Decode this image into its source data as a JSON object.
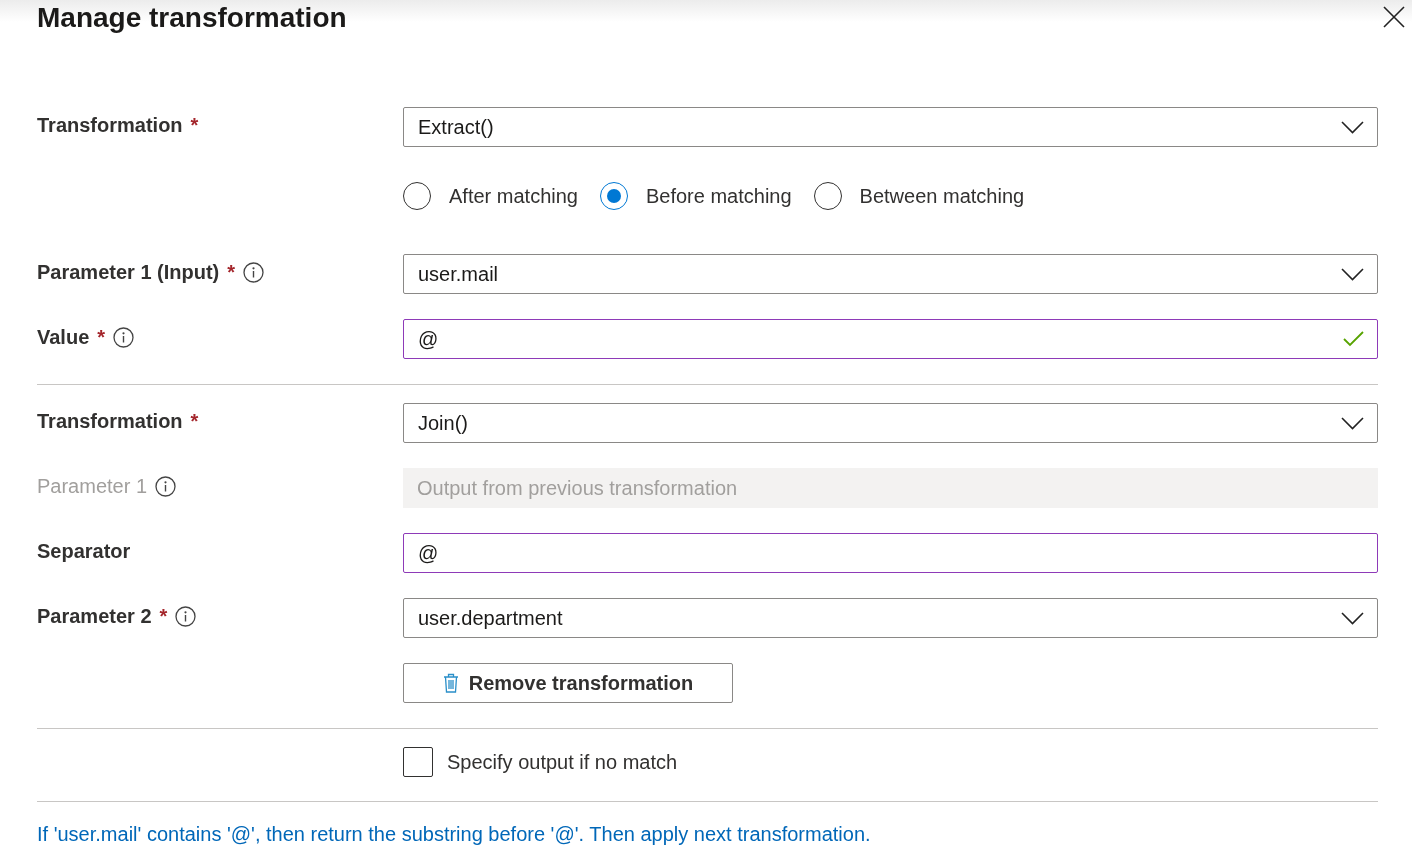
{
  "title": "Manage transformation",
  "sections": [
    {
      "rows": [
        {
          "kind": "dropdown",
          "label": "Transformation",
          "required_mark": "*",
          "info": false,
          "value": "Extract()"
        },
        {
          "kind": "radios",
          "options": [
            {
              "label": "After matching",
              "selected": false
            },
            {
              "label": "Before matching",
              "selected": true
            },
            {
              "label": "Between matching",
              "selected": false
            }
          ]
        },
        {
          "kind": "dropdown",
          "label": "Parameter 1 (Input)",
          "required_mark": "*",
          "info": true,
          "value": "user.mail"
        },
        {
          "kind": "text",
          "label": "Value",
          "required_mark": "*",
          "info": true,
          "value": "@",
          "valid": true
        }
      ]
    },
    {
      "rows": [
        {
          "kind": "dropdown",
          "label": "Transformation",
          "required_mark": "*",
          "info": false,
          "value": "Join()"
        },
        {
          "kind": "disabled",
          "label": "Parameter 1",
          "info": true,
          "placeholder": "Output from previous transformation"
        },
        {
          "kind": "text",
          "label": "Separator",
          "info": false,
          "value": "@",
          "valid": false
        },
        {
          "kind": "dropdown",
          "label": "Parameter 2",
          "required_mark": "*",
          "info": true,
          "value": "user.department"
        },
        {
          "kind": "button",
          "label": "Remove transformation"
        }
      ]
    },
    {
      "rows": [
        {
          "kind": "checkbox",
          "label": "Specify output if no match",
          "checked": false
        }
      ]
    }
  ],
  "summary": "If 'user.mail' contains '@', then return the substring before '@'. Then apply next transformation."
}
